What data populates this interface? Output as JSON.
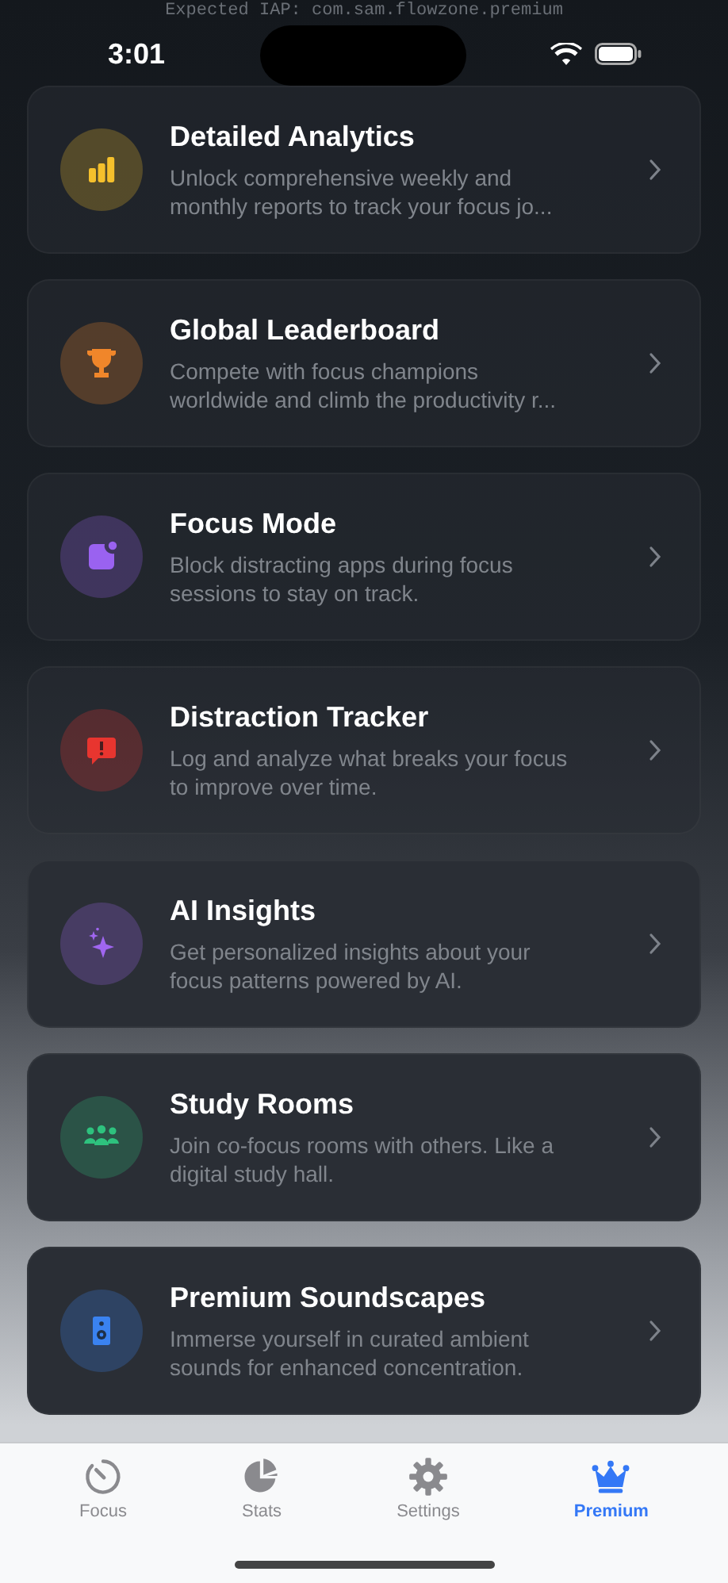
{
  "debug_text": "Expected IAP: com.sam.flowzone.premium",
  "status_bar": {
    "time": "3:01"
  },
  "features": [
    {
      "kind": "chart",
      "color": "#f5c02c",
      "title": "Detailed Analytics",
      "description": "Unlock comprehensive weekly and monthly reports to track your focus jo..."
    },
    {
      "kind": "trophy",
      "color": "#f0862a",
      "title": "Global Leaderboard",
      "description": "Compete with focus champions worldwide and climb the productivity r..."
    },
    {
      "kind": "app-badge",
      "color": "#9a62f0",
      "title": "Focus Mode",
      "description": "Block distracting apps during focus sessions to stay on track."
    },
    {
      "kind": "alert",
      "color": "#e8352f",
      "title": "Distraction Tracker",
      "description": "Log and analyze what breaks your focus to improve over time."
    },
    {
      "kind": "sparkles",
      "color": "#a066f0",
      "title": "AI Insights",
      "description": "Get personalized insights about your focus patterns powered by AI."
    },
    {
      "kind": "people",
      "color": "#2ec27e",
      "title": "Study Rooms",
      "description": "Join co-focus rooms with others. Like a digital study hall."
    },
    {
      "kind": "speaker",
      "color": "#3a82f0",
      "title": "Premium Soundscapes",
      "description": "Immerse yourself in curated ambient sounds for enhanced concentration."
    }
  ],
  "tab_bar": [
    {
      "kind": "timer",
      "label": "Focus",
      "selected": false
    },
    {
      "kind": "pie",
      "label": "Stats",
      "selected": false
    },
    {
      "kind": "gear",
      "label": "Settings",
      "selected": false
    },
    {
      "kind": "crown",
      "label": "Premium",
      "selected": true
    }
  ]
}
